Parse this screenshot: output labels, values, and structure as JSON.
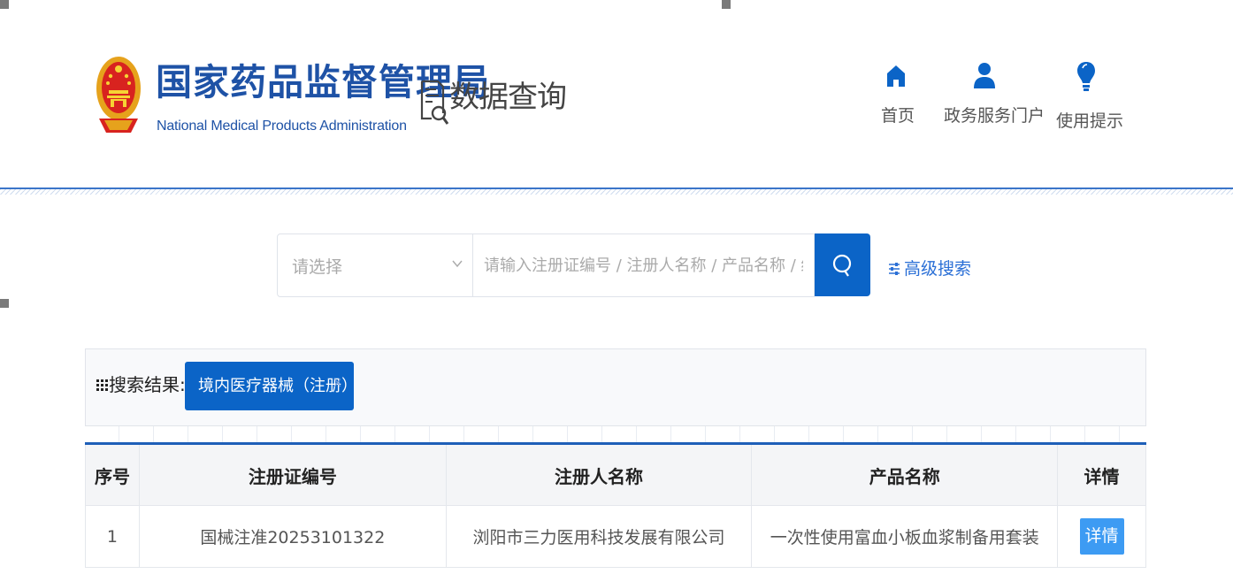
{
  "header": {
    "org_name_cn": "国家药品监督管理局",
    "org_name_en": "National Medical Products Administration",
    "data_query_label": "数据查询",
    "nav": [
      {
        "label": "首页",
        "icon": "home-icon"
      },
      {
        "label": "政务服务门户",
        "icon": "user-icon"
      },
      {
        "label": "使用提示",
        "icon": "lightbulb-icon"
      }
    ]
  },
  "search": {
    "select_placeholder": "请选择",
    "input_placeholder": "请输入注册证编号 / 注册人名称 / 产品名称 / 结构及组成/主",
    "advanced_label": "高级搜索"
  },
  "results": {
    "label": "搜索结果:",
    "filter_chip": "境内医疗器械（注册）",
    "chip_close": "x"
  },
  "table": {
    "headers": [
      "序号",
      "注册证编号",
      "注册人名称",
      "产品名称",
      "详情"
    ],
    "rows": [
      {
        "index": "1",
        "reg_no": "国械注准20253101322",
        "registrant": "浏阳市三力医用科技发展有限公司",
        "product": "一次性使用富血小板血浆制备用套装",
        "detail_label": "详情"
      }
    ]
  },
  "colors": {
    "brand_blue": "#1e52a6",
    "button_blue": "#0b64c7",
    "detail_blue": "#3d9bf3"
  }
}
